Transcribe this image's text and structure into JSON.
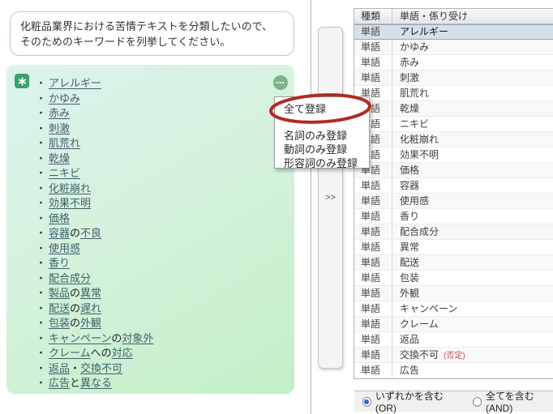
{
  "chat": {
    "user_message": "化粧品業界における苦情テキストを分類したいので、\nそのためのキーワードを列挙してください。",
    "assistant_icon": "chatgpt-logo",
    "more_button_label": "⋯",
    "assistant_keywords": [
      {
        "parts": [
          {
            "text": "アレルギー",
            "link": true
          }
        ]
      },
      {
        "parts": [
          {
            "text": "かゆみ",
            "link": true
          }
        ]
      },
      {
        "parts": [
          {
            "text": "赤み",
            "link": true
          }
        ]
      },
      {
        "parts": [
          {
            "text": "刺激",
            "link": true
          }
        ]
      },
      {
        "parts": [
          {
            "text": "肌荒れ",
            "link": true
          }
        ]
      },
      {
        "parts": [
          {
            "text": "乾燥",
            "link": true
          }
        ]
      },
      {
        "parts": [
          {
            "text": "ニキビ",
            "link": true
          }
        ]
      },
      {
        "parts": [
          {
            "text": "化粧崩れ",
            "link": true
          }
        ]
      },
      {
        "parts": [
          {
            "text": "効果不明",
            "link": true
          }
        ]
      },
      {
        "parts": [
          {
            "text": "価格",
            "link": true
          }
        ]
      },
      {
        "parts": [
          {
            "text": "容器",
            "link": true
          },
          {
            "text": "の",
            "link": false
          },
          {
            "text": "不良",
            "link": true
          }
        ]
      },
      {
        "parts": [
          {
            "text": "使用感",
            "link": true
          }
        ]
      },
      {
        "parts": [
          {
            "text": "香り",
            "link": true
          }
        ]
      },
      {
        "parts": [
          {
            "text": "配合成分",
            "link": true
          }
        ]
      },
      {
        "parts": [
          {
            "text": "製品",
            "link": true
          },
          {
            "text": "の",
            "link": false
          },
          {
            "text": "異常",
            "link": true
          }
        ]
      },
      {
        "parts": [
          {
            "text": "配送",
            "link": true
          },
          {
            "text": "の",
            "link": false
          },
          {
            "text": "遅れ",
            "link": true
          }
        ]
      },
      {
        "parts": [
          {
            "text": "包装",
            "link": true
          },
          {
            "text": "の",
            "link": false
          },
          {
            "text": "外観",
            "link": true
          }
        ]
      },
      {
        "parts": [
          {
            "text": "キャンペーン",
            "link": true
          },
          {
            "text": "の",
            "link": false
          },
          {
            "text": "対象外",
            "link": true
          }
        ]
      },
      {
        "parts": [
          {
            "text": "クレーム",
            "link": true
          },
          {
            "text": "への",
            "link": false
          },
          {
            "text": "対応",
            "link": true
          }
        ]
      },
      {
        "parts": [
          {
            "text": "返品",
            "link": true
          },
          {
            "text": "・",
            "link": false
          },
          {
            "text": "交換不可",
            "link": true
          }
        ]
      },
      {
        "parts": [
          {
            "text": "広告",
            "link": true
          },
          {
            "text": "と",
            "link": false
          },
          {
            "text": "異なる",
            "link": true
          }
        ]
      }
    ]
  },
  "context_menu": {
    "items": [
      "全て登録",
      "名詞のみ登録",
      "動詞のみ登録",
      "形容詞のみ登録"
    ],
    "circled_item": "全て登録"
  },
  "transfer_button_label": ">>",
  "table": {
    "columns": [
      "種類",
      "単語・係り受け"
    ],
    "rows": [
      {
        "category": "単語",
        "word": "アレルギー",
        "selected": true
      },
      {
        "category": "単語",
        "word": "かゆみ"
      },
      {
        "category": "単語",
        "word": "赤み"
      },
      {
        "category": "単語",
        "word": "刺激"
      },
      {
        "category": "単語",
        "word": "肌荒れ"
      },
      {
        "category": "単語",
        "word": "乾燥"
      },
      {
        "category": "単語",
        "word": "ニキビ"
      },
      {
        "category": "単語",
        "word": "化粧崩れ"
      },
      {
        "category": "単語",
        "word": "効果不明"
      },
      {
        "category": "単語",
        "word": "価格"
      },
      {
        "category": "単語",
        "word": "容器"
      },
      {
        "category": "単語",
        "word": "使用感"
      },
      {
        "category": "単語",
        "word": "香り"
      },
      {
        "category": "単語",
        "word": "配合成分"
      },
      {
        "category": "単語",
        "word": "異常"
      },
      {
        "category": "単語",
        "word": "配送"
      },
      {
        "category": "単語",
        "word": "包装"
      },
      {
        "category": "単語",
        "word": "外観"
      },
      {
        "category": "単語",
        "word": "キャンペーン"
      },
      {
        "category": "単語",
        "word": "クレーム"
      },
      {
        "category": "単語",
        "word": "返品"
      },
      {
        "category": "単語",
        "word": "交換不可",
        "note": "(否定)"
      },
      {
        "category": "単語",
        "word": "広告"
      }
    ]
  },
  "filter": {
    "options": [
      {
        "label": "いずれかを含む(OR)",
        "selected": true
      },
      {
        "label": "全てを含む(AND)",
        "selected": false
      }
    ]
  },
  "colors": {
    "annotation_red": "#b02b20",
    "gpt_green": "#3f9e71",
    "assistant_bubble_green": "#c3efc7",
    "selected_row_blue": "#d7e0e9",
    "note_red": "#c0504d",
    "radio_dot_blue": "#2a66c8"
  }
}
